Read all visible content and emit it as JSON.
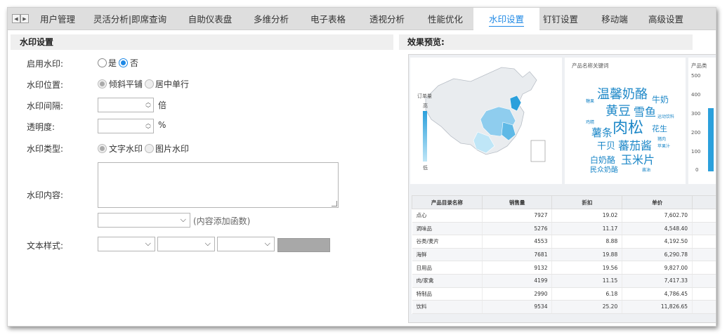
{
  "tabs": [
    {
      "label": "用户管理"
    },
    {
      "label": "灵活分析|即席查询"
    },
    {
      "label": "自助仪表盘"
    },
    {
      "label": "多维分析"
    },
    {
      "label": "电子表格"
    },
    {
      "label": "透视分析"
    },
    {
      "label": "性能优化"
    },
    {
      "label": "水印设置"
    },
    {
      "label": "钉钉设置"
    },
    {
      "label": "移动端"
    },
    {
      "label": "高级设置"
    }
  ],
  "settings": {
    "section_title": "水印设置",
    "enable": {
      "label": "启用水印:",
      "yes": "是",
      "no": "否",
      "selected": "否"
    },
    "position": {
      "label": "水印位置:",
      "opt1": "倾斜平铺",
      "opt2": "居中单行",
      "selected": "倾斜平铺"
    },
    "spacing": {
      "label": "水印间隔:",
      "unit": "倍"
    },
    "opacity": {
      "label": "透明度:",
      "unit": "%"
    },
    "type": {
      "label": "水印类型:",
      "opt1": "文字水印",
      "opt2": "图片水印",
      "selected": "文字水印"
    },
    "content": {
      "label": "水印内容:",
      "hint": "(内容添加函数)"
    },
    "text_style": {
      "label": "文本样式:"
    }
  },
  "preview": {
    "title": "效果预览:",
    "map": {
      "legend_title": "订单量",
      "legend_high": "高",
      "legend_low": "低"
    },
    "cloud": {
      "title": "产品名称关键词",
      "words": [
        "温馨奶酪",
        "黄豆",
        "雪鱼",
        "肉松",
        "薯条",
        "牛奶",
        "花生",
        "干贝",
        "蕃茄酱",
        "白奶酪",
        "玉米片",
        "民众奶酪",
        "运动饮料",
        "猪肉",
        "苹果汁",
        "糖果",
        "鸡精",
        "酱油"
      ]
    },
    "bar": {
      "title": "产品类",
      "ticks": [
        "500",
        "400",
        "300",
        "200",
        "100",
        "0"
      ]
    },
    "table": {
      "headers": [
        "产品目录名称",
        "销售量",
        "折扣",
        "单价"
      ],
      "rows": [
        [
          "点心",
          "7927",
          "19.02",
          "7,602.70"
        ],
        [
          "调味品",
          "5276",
          "11.17",
          "4,548.40"
        ],
        [
          "谷类/麦片",
          "4553",
          "8.88",
          "4,192.50"
        ],
        [
          "海鲜",
          "7681",
          "19.88",
          "6,290.78"
        ],
        [
          "日用品",
          "9132",
          "19.56",
          "9,827.00"
        ],
        [
          "肉/家禽",
          "4199",
          "11.15",
          "7,417.33"
        ],
        [
          "特制品",
          "2990",
          "6.18",
          "4,786.45"
        ],
        [
          "饮料",
          "9534",
          "25.20",
          "11,826.65"
        ]
      ]
    }
  }
}
